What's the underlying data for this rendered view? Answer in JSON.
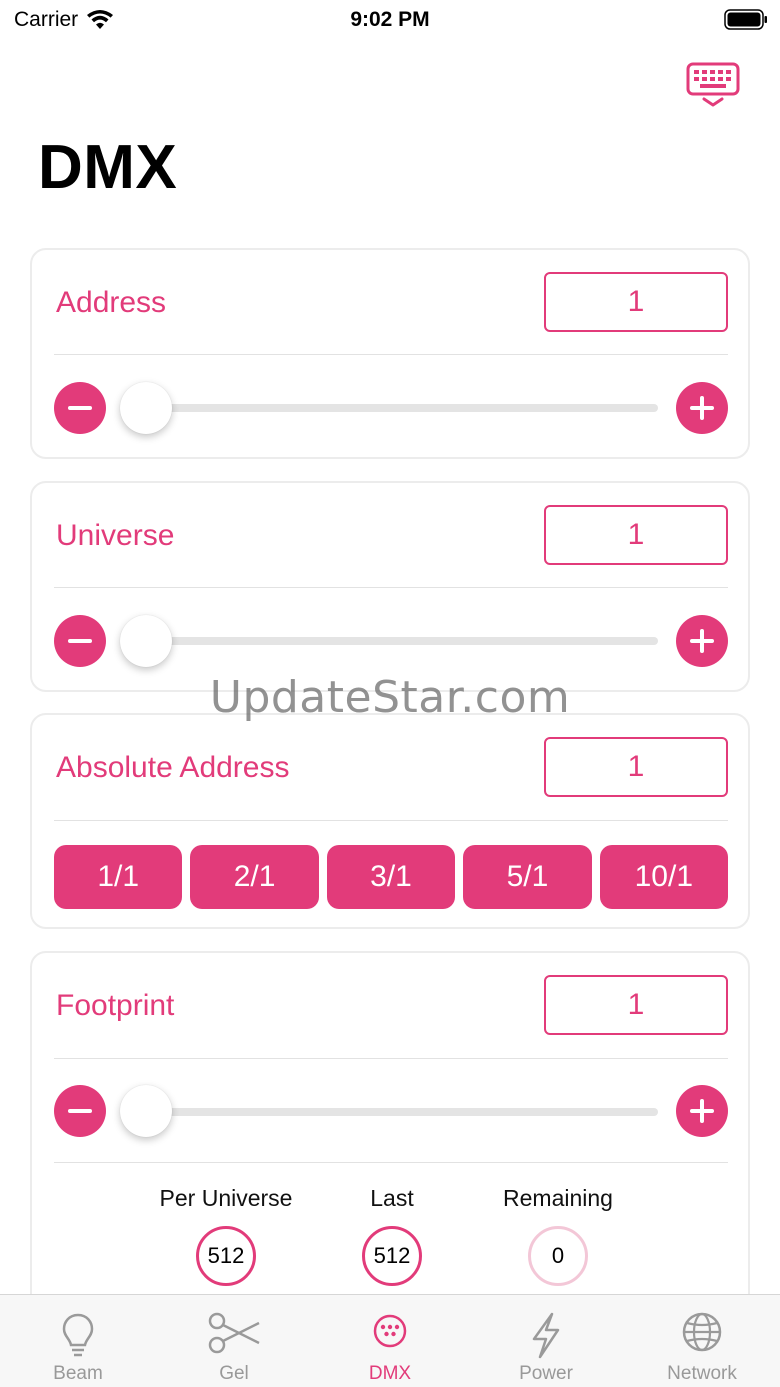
{
  "status_bar": {
    "carrier": "Carrier",
    "time": "9:02 PM"
  },
  "header": {
    "title": "DMX",
    "keyboard_icon": "keyboard-hide-icon"
  },
  "accent_color": "#e23b7a",
  "address": {
    "label": "Address",
    "value": "1",
    "slider_fraction": 0
  },
  "universe": {
    "label": "Universe",
    "value": "1",
    "slider_fraction": 0
  },
  "absolute_address": {
    "label": "Absolute Address",
    "value": "1",
    "presets": [
      "1/1",
      "2/1",
      "3/1",
      "5/1",
      "10/1"
    ]
  },
  "footprint": {
    "label": "Footprint",
    "value": "1",
    "slider_fraction": 0,
    "stats": [
      {
        "label": "Per Universe",
        "value": "512"
      },
      {
        "label": "Last",
        "value": "512"
      },
      {
        "label": "Remaining",
        "value": "0"
      }
    ]
  },
  "watermark": "UpdateStar.com",
  "tabs": [
    {
      "label": "Beam",
      "icon": "lightbulb-icon",
      "active": false
    },
    {
      "label": "Gel",
      "icon": "scissors-icon",
      "active": false
    },
    {
      "label": "DMX",
      "icon": "dmx-connector-icon",
      "active": true
    },
    {
      "label": "Power",
      "icon": "lightning-icon",
      "active": false
    },
    {
      "label": "Network",
      "icon": "globe-icon",
      "active": false
    }
  ]
}
